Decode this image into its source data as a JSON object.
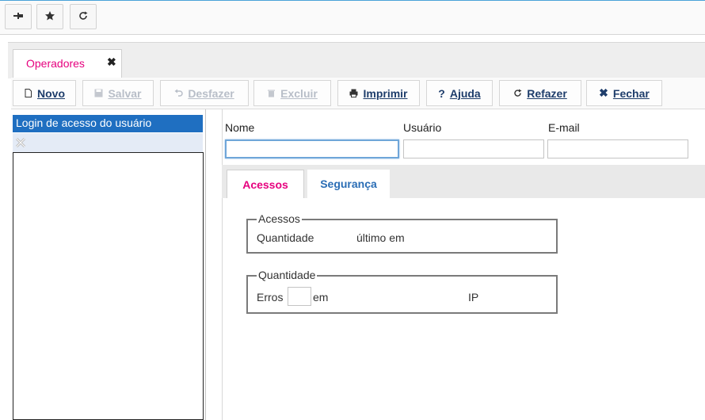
{
  "quick_toolbar": {
    "buttons": [
      {
        "icon": "pin-icon"
      },
      {
        "icon": "star-icon"
      },
      {
        "icon": "refresh-icon"
      }
    ]
  },
  "doc_tab": {
    "label": "Operadores",
    "close": "✖"
  },
  "actions": {
    "novo": "Novo",
    "salvar": "Salvar",
    "desfazer": "Desfazer",
    "excluir": "Excluir",
    "imprimir": "Imprimir",
    "ajuda": "Ajuda",
    "refazer": "Refazer",
    "fechar": "Fechar",
    "ajuda_glyph": "?",
    "fechar_glyph": "✖",
    "disabled": [
      "salvar",
      "desfazer",
      "excluir"
    ]
  },
  "list": {
    "header": "Login de acesso do usuário"
  },
  "form": {
    "nome_label": "Nome",
    "usuario_label": "Usuário",
    "email_label": "E-mail",
    "nome_value": "",
    "usuario_value": "",
    "email_value": ""
  },
  "inner_tabs": {
    "acessos": "Acessos",
    "seguranca": "Segurança",
    "active": "acessos"
  },
  "acessos_group": {
    "legend": "Acessos",
    "quantidade": "Quantidade",
    "ultimo_em": "último em"
  },
  "quantidade_group": {
    "legend": "Quantidade",
    "erros": "Erros",
    "em": "em",
    "ip": "IP",
    "erros_value": ""
  },
  "colors": {
    "accent": "#e6007e",
    "selection": "#1f6fc1",
    "button_text": "#1e3d6b",
    "tab_link": "#2a6db5"
  }
}
